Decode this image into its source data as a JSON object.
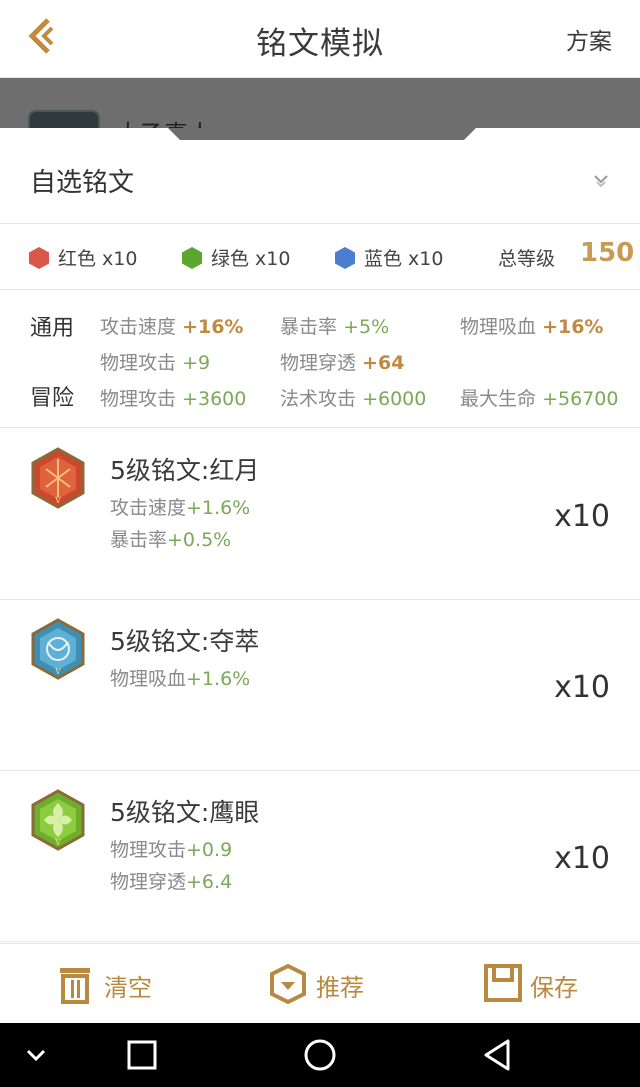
{
  "header": {
    "title": "铭文模拟",
    "plan_label": "方案"
  },
  "hero": {
    "name": "太乙真人"
  },
  "custom": {
    "label": "自选铭文"
  },
  "colors": [
    {
      "label": "红色 x10",
      "color": "#d9584a"
    },
    {
      "label": "绿色 x10",
      "color": "#5aa62e"
    },
    {
      "label": "蓝色 x10",
      "color": "#4a7fd0"
    }
  ],
  "total_level": {
    "label": "总等级",
    "value": "150"
  },
  "stats": {
    "general_label": "通用",
    "adventure_label": "冒险",
    "general": [
      {
        "name": "攻击速度",
        "value": "+16%"
      },
      {
        "name": "暴击率",
        "value": "+5%"
      },
      {
        "name": "物理吸血",
        "value": "+16%"
      },
      {
        "name": "物理攻击",
        "value": "+9"
      },
      {
        "name": "物理穿透",
        "value": "+64"
      }
    ],
    "adventure": [
      {
        "name": "物理攻击",
        "value": "+3600"
      },
      {
        "name": "法术攻击",
        "value": "+6000"
      },
      {
        "name": "最大生命",
        "value": "+56700"
      }
    ]
  },
  "runes": [
    {
      "name": "5级铭文:红月",
      "icon": "red-moon-rune-icon",
      "color": "#c9482e",
      "stats": [
        {
          "name": "攻击速度",
          "value": "+1.6%"
        },
        {
          "name": "暴击率",
          "value": "+0.5%"
        }
      ],
      "count": "x10"
    },
    {
      "name": "5级铭文:夺萃",
      "icon": "duocui-rune-icon",
      "color": "#3f8fb5",
      "stats": [
        {
          "name": "物理吸血",
          "value": "+1.6%"
        }
      ],
      "count": "x10"
    },
    {
      "name": "5级铭文:鹰眼",
      "icon": "hawk-eye-rune-icon",
      "color": "#6fae2c",
      "stats": [
        {
          "name": "物理攻击",
          "value": "+0.9"
        },
        {
          "name": "物理穿透",
          "value": "+6.4"
        }
      ],
      "count": "x10"
    }
  ],
  "toolbar": {
    "clear_label": "清空",
    "recommend_label": "推荐",
    "save_label": "保存"
  },
  "accent_color": "#b8893e"
}
